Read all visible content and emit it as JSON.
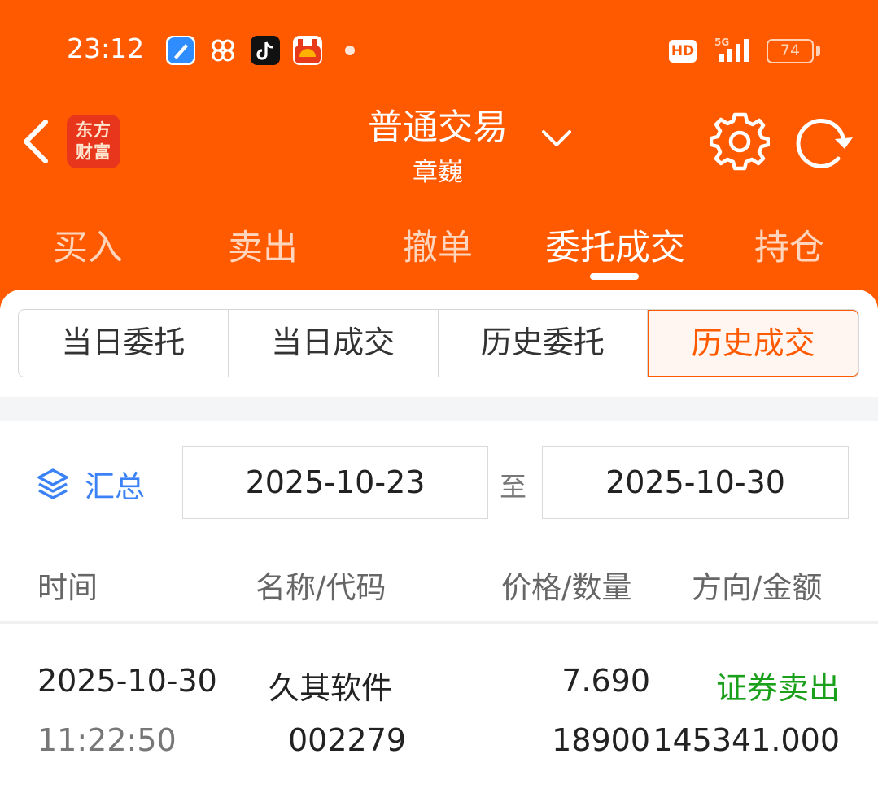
{
  "status_bar": {
    "time": "23:12",
    "app_icons": [
      "browser-app-icon",
      "grid-app-icon",
      "tiktok-app-icon",
      "news-app-icon"
    ],
    "network_badge": "HD",
    "network_type": "5G",
    "battery": "74"
  },
  "header": {
    "logo_line1": "东方",
    "logo_line2": "财富",
    "title": "普通交易",
    "account": "章巍"
  },
  "tabs": [
    {
      "label": "买入"
    },
    {
      "label": "卖出"
    },
    {
      "label": "撤单"
    },
    {
      "label": "委托成交",
      "active": true
    },
    {
      "label": "持仓"
    }
  ],
  "subtabs": [
    {
      "label": "当日委托"
    },
    {
      "label": "当日成交"
    },
    {
      "label": "历史委托"
    },
    {
      "label": "历史成交",
      "active": true
    }
  ],
  "filter": {
    "summary_label": "汇总",
    "start_date": "2025-10-23",
    "to_label": "至",
    "end_date": "2025-10-30"
  },
  "table": {
    "headers": [
      "时间",
      "名称/代码",
      "价格/数量",
      "方向/金额"
    ],
    "rows": [
      {
        "date": "2025-10-30",
        "time": "11:22:50",
        "name": "久其软件",
        "code": "002279",
        "price": "7.690",
        "quantity": "18900",
        "direction": "证券卖出",
        "amount": "145341.000"
      }
    ]
  },
  "colors": {
    "brand": "#ff5a00",
    "link": "#3b82f6",
    "sell": "#1aa01a"
  }
}
